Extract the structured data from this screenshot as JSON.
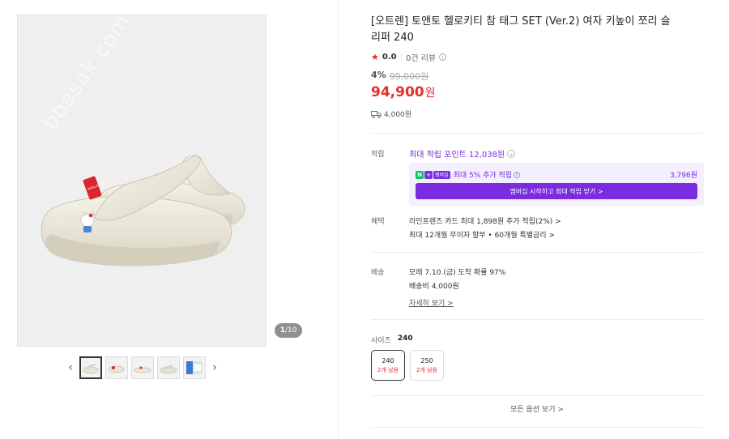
{
  "gallery": {
    "watermark": "bbasak.com",
    "counter_current": "1",
    "counter_total": "/10",
    "prev_icon": "‹",
    "next_icon": "›"
  },
  "product": {
    "title": "[오트렌] 토앤토 헬로키티 참 태그 SET (Ver.2) 여자 키높이 쪼리 슬리퍼 240",
    "rating_score": "0.0",
    "review_count": "0건 리뷰",
    "discount_rate": "4%",
    "original_price": "99,000원",
    "price": "94,900",
    "price_unit": "원",
    "shipping_fee": "4,000원"
  },
  "reward": {
    "label": "적립",
    "title": "최대 적립 포인트 12,038원",
    "member_badge_n": "N",
    "member_badge_plus": "+",
    "member_badge_text": "멤버십",
    "member_text": "최대 5% 추가 적립",
    "member_amount": "3,796원",
    "member_button": "멤버십 시작하고 최대 적립 받기 >"
  },
  "benefits": {
    "label": "혜택",
    "line1": "라인프렌즈 카드 최대 1,898원 추가 적립(2%) >",
    "line2": "최대 12개월 무이자 할부 • 60개월 특별금리 >"
  },
  "delivery": {
    "label": "배송",
    "line1": "모레 7.10.(금) 도착 확률 97%",
    "line2": "배송비 4,000원",
    "details_link": "자세히 보기 >"
  },
  "size": {
    "label": "사이즈",
    "selected": "240",
    "options": [
      {
        "size": "240",
        "stock": "2개 남음"
      },
      {
        "size": "250",
        "stock": "2개 남음"
      }
    ],
    "all_options": "모든 옵션 보기 >"
  },
  "colors": {
    "accent_red": "#e42d2d",
    "accent_purple": "#7b2ce0",
    "naver_green": "#03c75a"
  }
}
